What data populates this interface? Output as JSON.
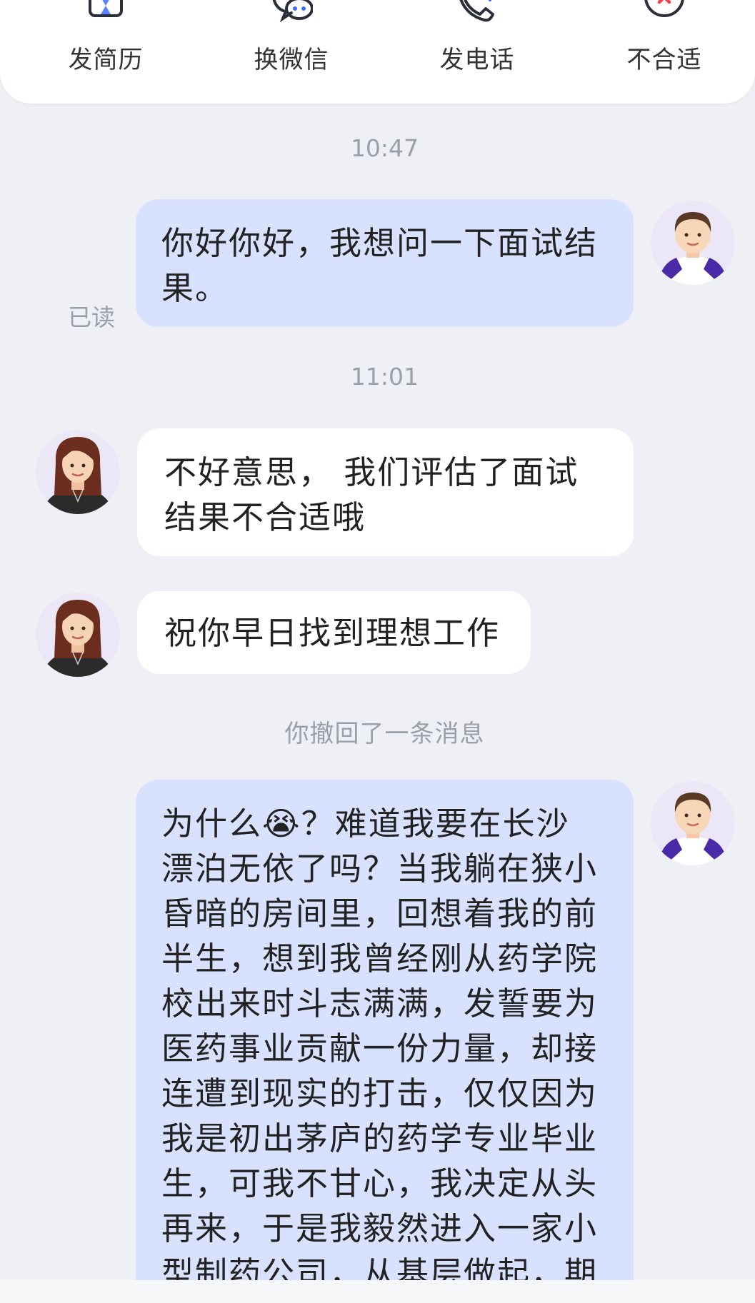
{
  "actions": [
    {
      "label": "发简历",
      "icon": "resume-icon"
    },
    {
      "label": "换微信",
      "icon": "wechat-icon"
    },
    {
      "label": "发电话",
      "icon": "phone-icon"
    },
    {
      "label": "不合适",
      "icon": "reject-icon"
    }
  ],
  "messages": {
    "time_1": "10:47",
    "msg_1": "你好你好，我想问一下面试结\n果。",
    "read_status": "已读",
    "time_2": "11:01",
    "msg_2": "不好意思， 我们评估了面试\n结果不合适哦",
    "msg_3": "祝你早日找到理想工作",
    "system_recall": "你撤回了一条消息",
    "msg_4": "为什么😭？难道我要在长沙\n漂泊无依了吗？当我躺在狭小\n昏暗的房间里，回想着我的前\n半生，想到我曾经刚从药学院\n校出来时斗志满满，发誓要为\n医药事业贡献一份力量，却接\n连遭到现实的打击，仅仅因为\n我是初出茅庐的药学专业毕业\n生，可我不甘心，我决定从头\n再来，于是我毅然进入一家小\n型制药公司，从基层做起，期"
  },
  "colors": {
    "my_bubble": "#d8e2ff",
    "other_bubble": "#ffffff",
    "background": "#eef0f5",
    "accent": "#3d6bff",
    "reject": "#ff3b4a"
  }
}
